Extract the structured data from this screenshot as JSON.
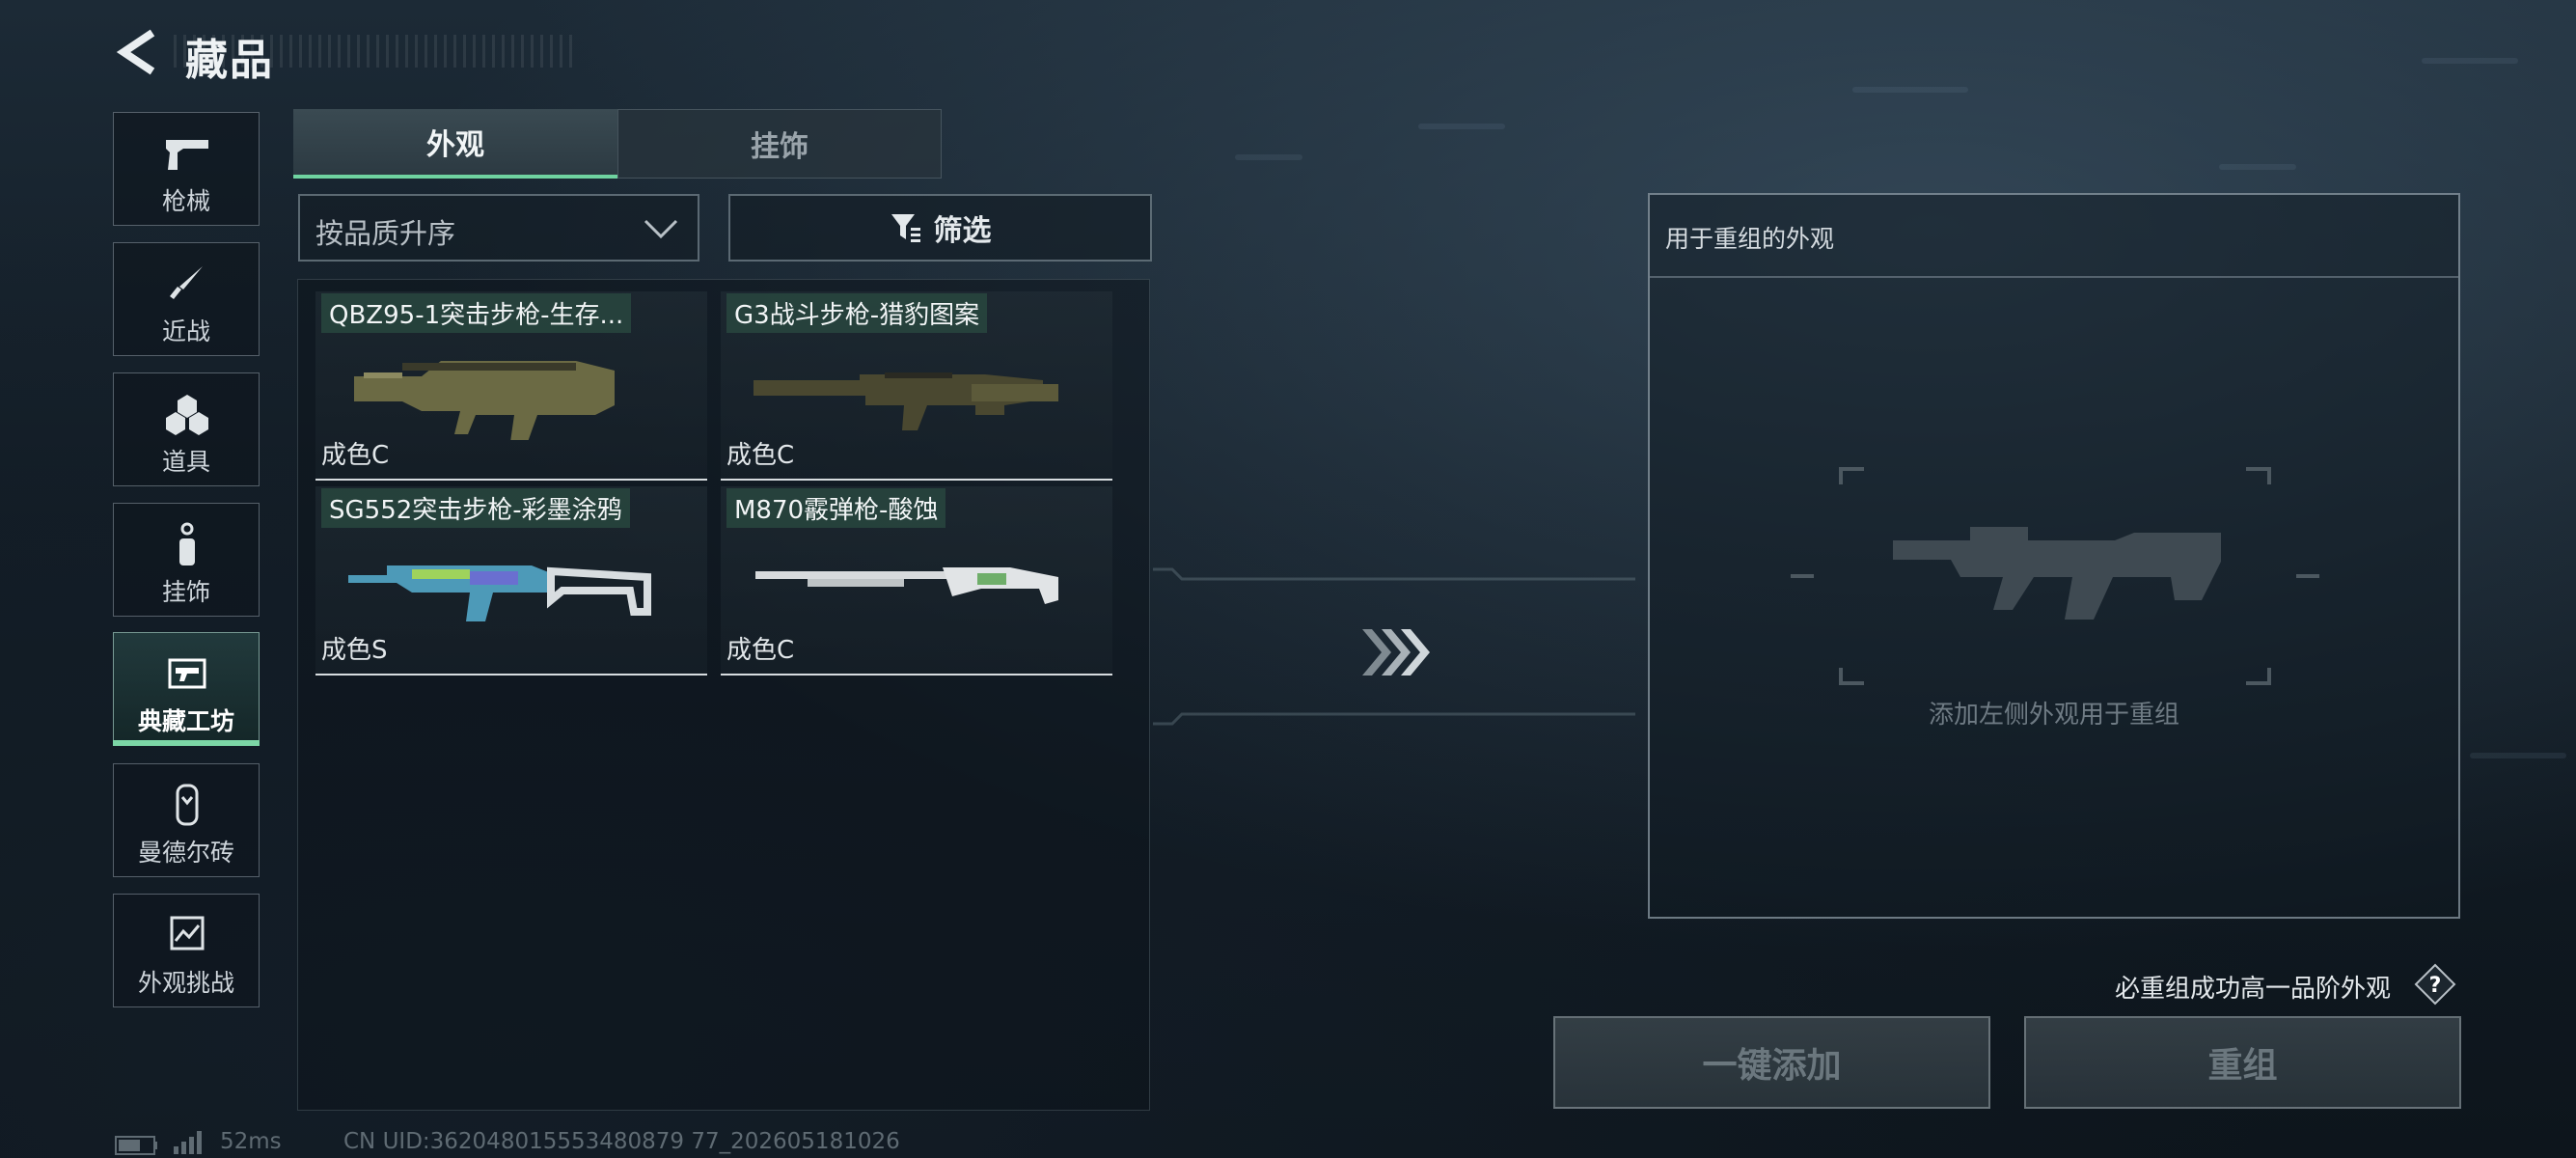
{
  "header": {
    "title": "藏品"
  },
  "sidebar": {
    "items": [
      {
        "label": "枪械",
        "icon": "pistol-icon"
      },
      {
        "label": "近战",
        "icon": "knife-icon"
      },
      {
        "label": "道具",
        "icon": "grenades-icon"
      },
      {
        "label": "挂饰",
        "icon": "charm-icon"
      },
      {
        "label": "典藏工坊",
        "icon": "workshop-gun-icon",
        "active": true
      },
      {
        "label": "曼德尔砖",
        "icon": "mandel-brick-icon"
      },
      {
        "label": "外观挑战",
        "icon": "challenge-icon"
      }
    ]
  },
  "tabs": [
    {
      "label": "外观",
      "active": true
    },
    {
      "label": "挂饰",
      "active": false
    }
  ],
  "sort": {
    "value": "按品质升序"
  },
  "filter": {
    "label": "筛选"
  },
  "items": [
    {
      "name": "QBZ95-1突击步枪-生存...",
      "grade": "成色C"
    },
    {
      "name": "G3战斗步枪-猎豹图案",
      "grade": "成色C"
    },
    {
      "name": "SG552突击步枪-彩墨涂鸦",
      "grade": "成色S"
    },
    {
      "name": "M870霰弹枪-酸蚀",
      "grade": "成色C"
    }
  ],
  "remix": {
    "title": "用于重组的外观",
    "hint": "添加左侧外观用于重组",
    "note": "必重组成功高一品阶外观",
    "add_label": "一键添加",
    "remix_label": "重组"
  },
  "status": {
    "ping": "52ms",
    "uid": "CN UID:362048015553480879 77_202605181026"
  },
  "colors": {
    "accent": "#6fd3a0",
    "background": "#121c25"
  }
}
